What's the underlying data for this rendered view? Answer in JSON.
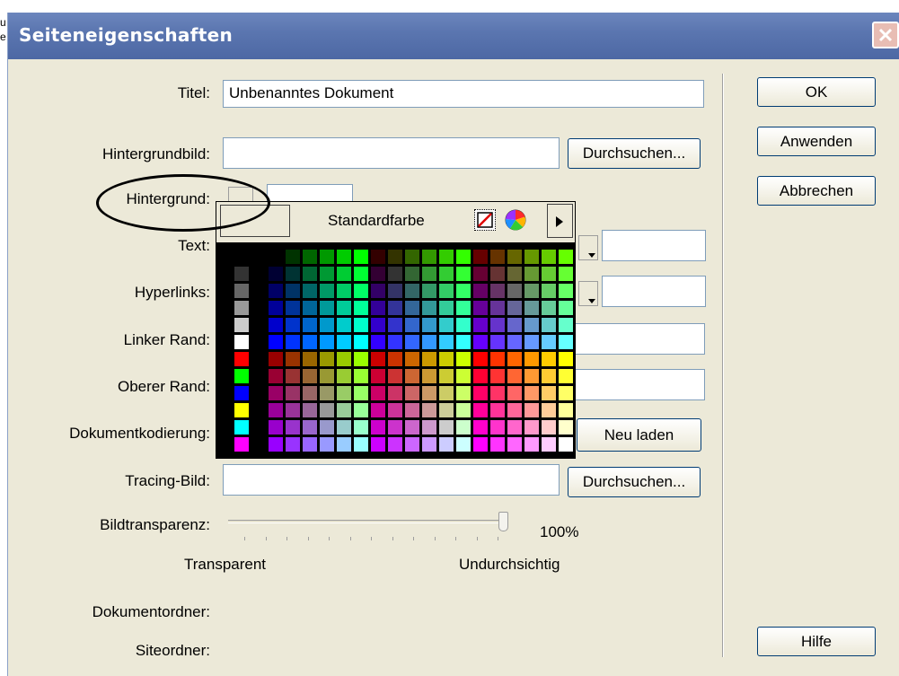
{
  "window": {
    "title": "Seiteneigenschaften"
  },
  "labels": {
    "titel": "Titel:",
    "hintergrundbild": "Hintergrundbild:",
    "hintergrund": "Hintergrund:",
    "text": "Text:",
    "hyperlinks": "Hyperlinks:",
    "linker_rand": "Linker Rand:",
    "oberer_rand": "Oberer Rand:",
    "dokumentkodierung": "Dokumentkodierung:",
    "tracing_bild": "Tracing-Bild:",
    "bildtransparenz": "Bildtransparenz:",
    "dokumentordner": "Dokumentordner:",
    "siteordner": "Siteordner:"
  },
  "fields": {
    "titel_value": "Unbenanntes Dokument",
    "hintergrundbild_value": "",
    "hintergrund_value": "",
    "text_value": "",
    "hyperlinks_value": "",
    "linker_rand_value": "",
    "oberer_rand_value": "",
    "tracing_bild_value": ""
  },
  "buttons": {
    "ok": "OK",
    "anwenden": "Anwenden",
    "abbrechen": "Abbrechen",
    "hilfe": "Hilfe",
    "durchsuchen_1": "Durchsuchen...",
    "durchsuchen_2": "Durchsuchen...",
    "neu_laden": "Neu laden"
  },
  "slider": {
    "value_percent": 100,
    "value_label": "100%",
    "min_label": "Transparent",
    "max_label": "Undurchsichtig"
  },
  "palette": {
    "standard_label": "Standardfarbe",
    "side_colors": [
      "#000000",
      "#333333",
      "#666666",
      "#999999",
      "#cccccc",
      "#ffffff",
      "#ff0000",
      "#00ff00",
      "#0000ff",
      "#ffff00",
      "#00ffff",
      "#ff00ff"
    ]
  },
  "edge_text": {
    "a": "u",
    "b": "e"
  },
  "icons": [
    "close-icon",
    "no-color-icon",
    "color-wheel-icon",
    "palette-menu-arrow-icon"
  ]
}
